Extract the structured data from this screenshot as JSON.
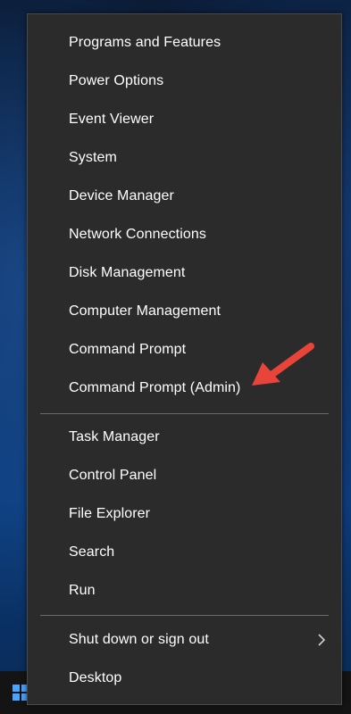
{
  "menu": {
    "group1": [
      {
        "label": "Programs and Features"
      },
      {
        "label": "Power Options"
      },
      {
        "label": "Event Viewer"
      },
      {
        "label": "System"
      },
      {
        "label": "Device Manager"
      },
      {
        "label": "Network Connections"
      },
      {
        "label": "Disk Management"
      },
      {
        "label": "Computer Management"
      },
      {
        "label": "Command Prompt"
      },
      {
        "label": "Command Prompt (Admin)"
      }
    ],
    "group2": [
      {
        "label": "Task Manager"
      },
      {
        "label": "Control Panel"
      },
      {
        "label": "File Explorer"
      },
      {
        "label": "Search"
      },
      {
        "label": "Run"
      }
    ],
    "group3": [
      {
        "label": "Shut down or sign out",
        "has_submenu": true
      },
      {
        "label": "Desktop"
      }
    ]
  },
  "annotation": {
    "icon": "red-arrow-icon",
    "color": "#e8443a"
  },
  "colors": {
    "menu_bg": "#2b2b2b",
    "text": "#ffffff",
    "separator": "#6a6a6a"
  }
}
